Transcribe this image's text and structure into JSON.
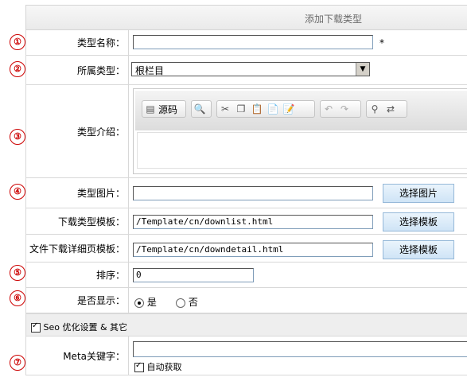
{
  "header": {
    "title": "添加下载类型"
  },
  "markers": [
    "①",
    "②",
    "③",
    "④",
    "⑤",
    "⑥",
    "⑦"
  ],
  "fields": {
    "name": {
      "label": "类型名称：",
      "value": "",
      "required": "*"
    },
    "parent": {
      "label": "所属类型：",
      "selected": "根栏目"
    },
    "intro": {
      "label": "类型介绍：",
      "source_label": "源码"
    },
    "image": {
      "label": "类型图片：",
      "value": "",
      "button": "选择图片"
    },
    "list_template": {
      "label": "下载类型模板：",
      "value": "/Template/cn/downlist.html",
      "button": "选择模板"
    },
    "detail_template": {
      "label": "文件下载详细页模板：",
      "value": "/Template/cn/downdetail.html",
      "button": "选择模板"
    },
    "order": {
      "label": "排序：",
      "value": "0"
    },
    "visible": {
      "label": "是否显示：",
      "yes": "是",
      "no": "否",
      "selected": "yes"
    }
  },
  "seo": {
    "header": "Seo 优化设置 & 其它",
    "meta_label": "Meta关键字：",
    "meta_value": "",
    "auto_label": "自动获取"
  },
  "colors": {
    "marker": "#cc0000",
    "button_bg": "#cfe4f6",
    "border": "#d8d8d8"
  }
}
